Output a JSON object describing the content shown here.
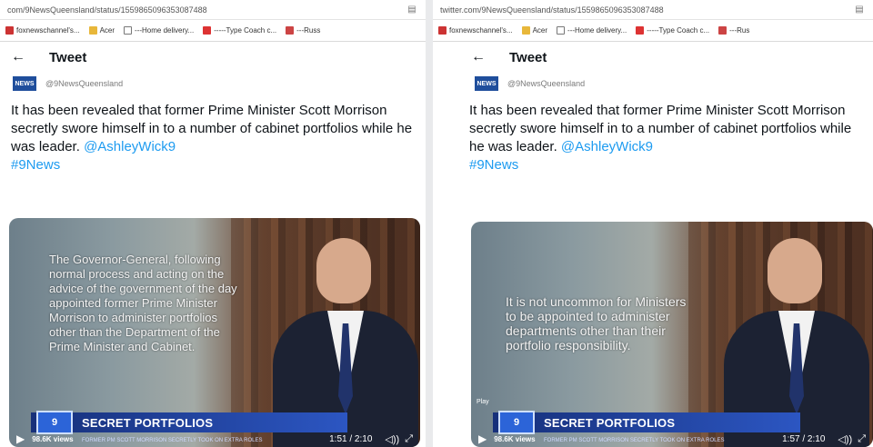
{
  "left": {
    "url": "com/9NewsQueensland/status/1559865096353087488",
    "bookmarks": [
      "foxnewschannel's...",
      "Acer",
      "---Home delivery...",
      "-----Type Coach c...",
      "---Russ"
    ],
    "header": {
      "title": "Tweet"
    },
    "author": {
      "logo": "NEWS",
      "handle": "@9NewsQueensland"
    },
    "tweet": {
      "text": "It has  been revealed that former Prime Minister Scott Morrison secretly swore himself in to a number of cabinet portfolios while he was leader.",
      "mention": "@AshleyWick9",
      "hashtag": "#9News"
    },
    "video": {
      "caption": "The Governor-General, following\nnormal process and acting on the\nadvice of the government of the day\nappointed former Prime Minister\nMorrison to administer portfolios\nother than the Department of the\nPrime Minister and Cabinet.",
      "logo": "9",
      "headline": "SECRET PORTFOLIOS",
      "subline": "FORMER PM SCOTT MORRISON SECRETLY TOOK ON EXTRA ROLES",
      "views": "98.6K views",
      "time": "1:51 / 2:10"
    }
  },
  "right": {
    "url": "twitter.com/9NewsQueensland/status/1559865096353087488",
    "bookmarks": [
      "foxnewschannel's...",
      "Acer",
      "---Home delivery...",
      "-----Type Coach c...",
      "---Rus"
    ],
    "header": {
      "title": "Tweet"
    },
    "author": {
      "logo": "NEWS",
      "handle": "@9NewsQueensland"
    },
    "tweet": {
      "text": "It has  been revealed that former Prime Minister Scott Morrison secretly swore himself in to a number of cabinet portfolios while he was leader.",
      "mention": "@AshleyWick9",
      "hashtag": "#9News"
    },
    "video": {
      "caption": "It is not uncommon for Ministers\nto be appointed to administer\ndepartments other than their\nportfolio responsibility.",
      "pause_label": "Play",
      "logo": "9",
      "headline": "SECRET PORTFOLIOS",
      "subline": "FORMER PM SCOTT MORRISON SECRETLY TOOK ON EXTRA ROLES",
      "views": "98.6K views",
      "time": "1:57 / 2:10"
    }
  }
}
